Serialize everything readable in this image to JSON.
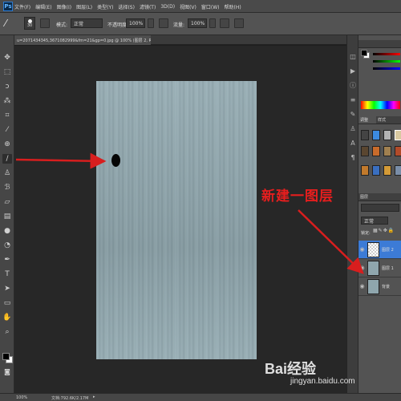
{
  "app": {
    "logo": "Ps",
    "menus": [
      "文件(F)",
      "编辑(E)",
      "图像(I)",
      "图层(L)",
      "类型(Y)",
      "选择(S)",
      "滤镜(T)",
      "3D(D)",
      "视图(V)",
      "窗口(W)",
      "帮助(H)"
    ]
  },
  "options": {
    "brush_size": "30",
    "mode_label": "模式:",
    "mode_value": "正常",
    "opacity_label": "不透明度:",
    "opacity_value": "100%",
    "flow_label": "流量:",
    "flow_value": "100%"
  },
  "document": {
    "tab_title": "u=2071434345,3671082999&fm=21&gp=0.jpg @ 100% (图层 2, RGB/8#) *",
    "zoom": "100%",
    "doc_info": "文档:792.6K/2.17M"
  },
  "panels": {
    "swatches_tab": "色板",
    "adjust_tab": "调整",
    "styles_tab": "样式",
    "layers_tab": "图层",
    "blend_mode": "正常",
    "lock_label": "锁定:",
    "layers": [
      {
        "name": "图层 2",
        "thumb": "transparent"
      },
      {
        "name": "图层 1",
        "thumb": "wood"
      },
      {
        "name": "背景",
        "thumb": "wood"
      }
    ]
  },
  "annotation": {
    "label": "新建一图层",
    "color": "#e61e1e"
  },
  "watermark": {
    "main": "Bai经验",
    "sub": "jingyan.baidu.com"
  },
  "colors": {
    "foreground": "#000000",
    "background": "#ffffff",
    "canvas_bg": "#272727",
    "wood": "#8fa6ad"
  }
}
